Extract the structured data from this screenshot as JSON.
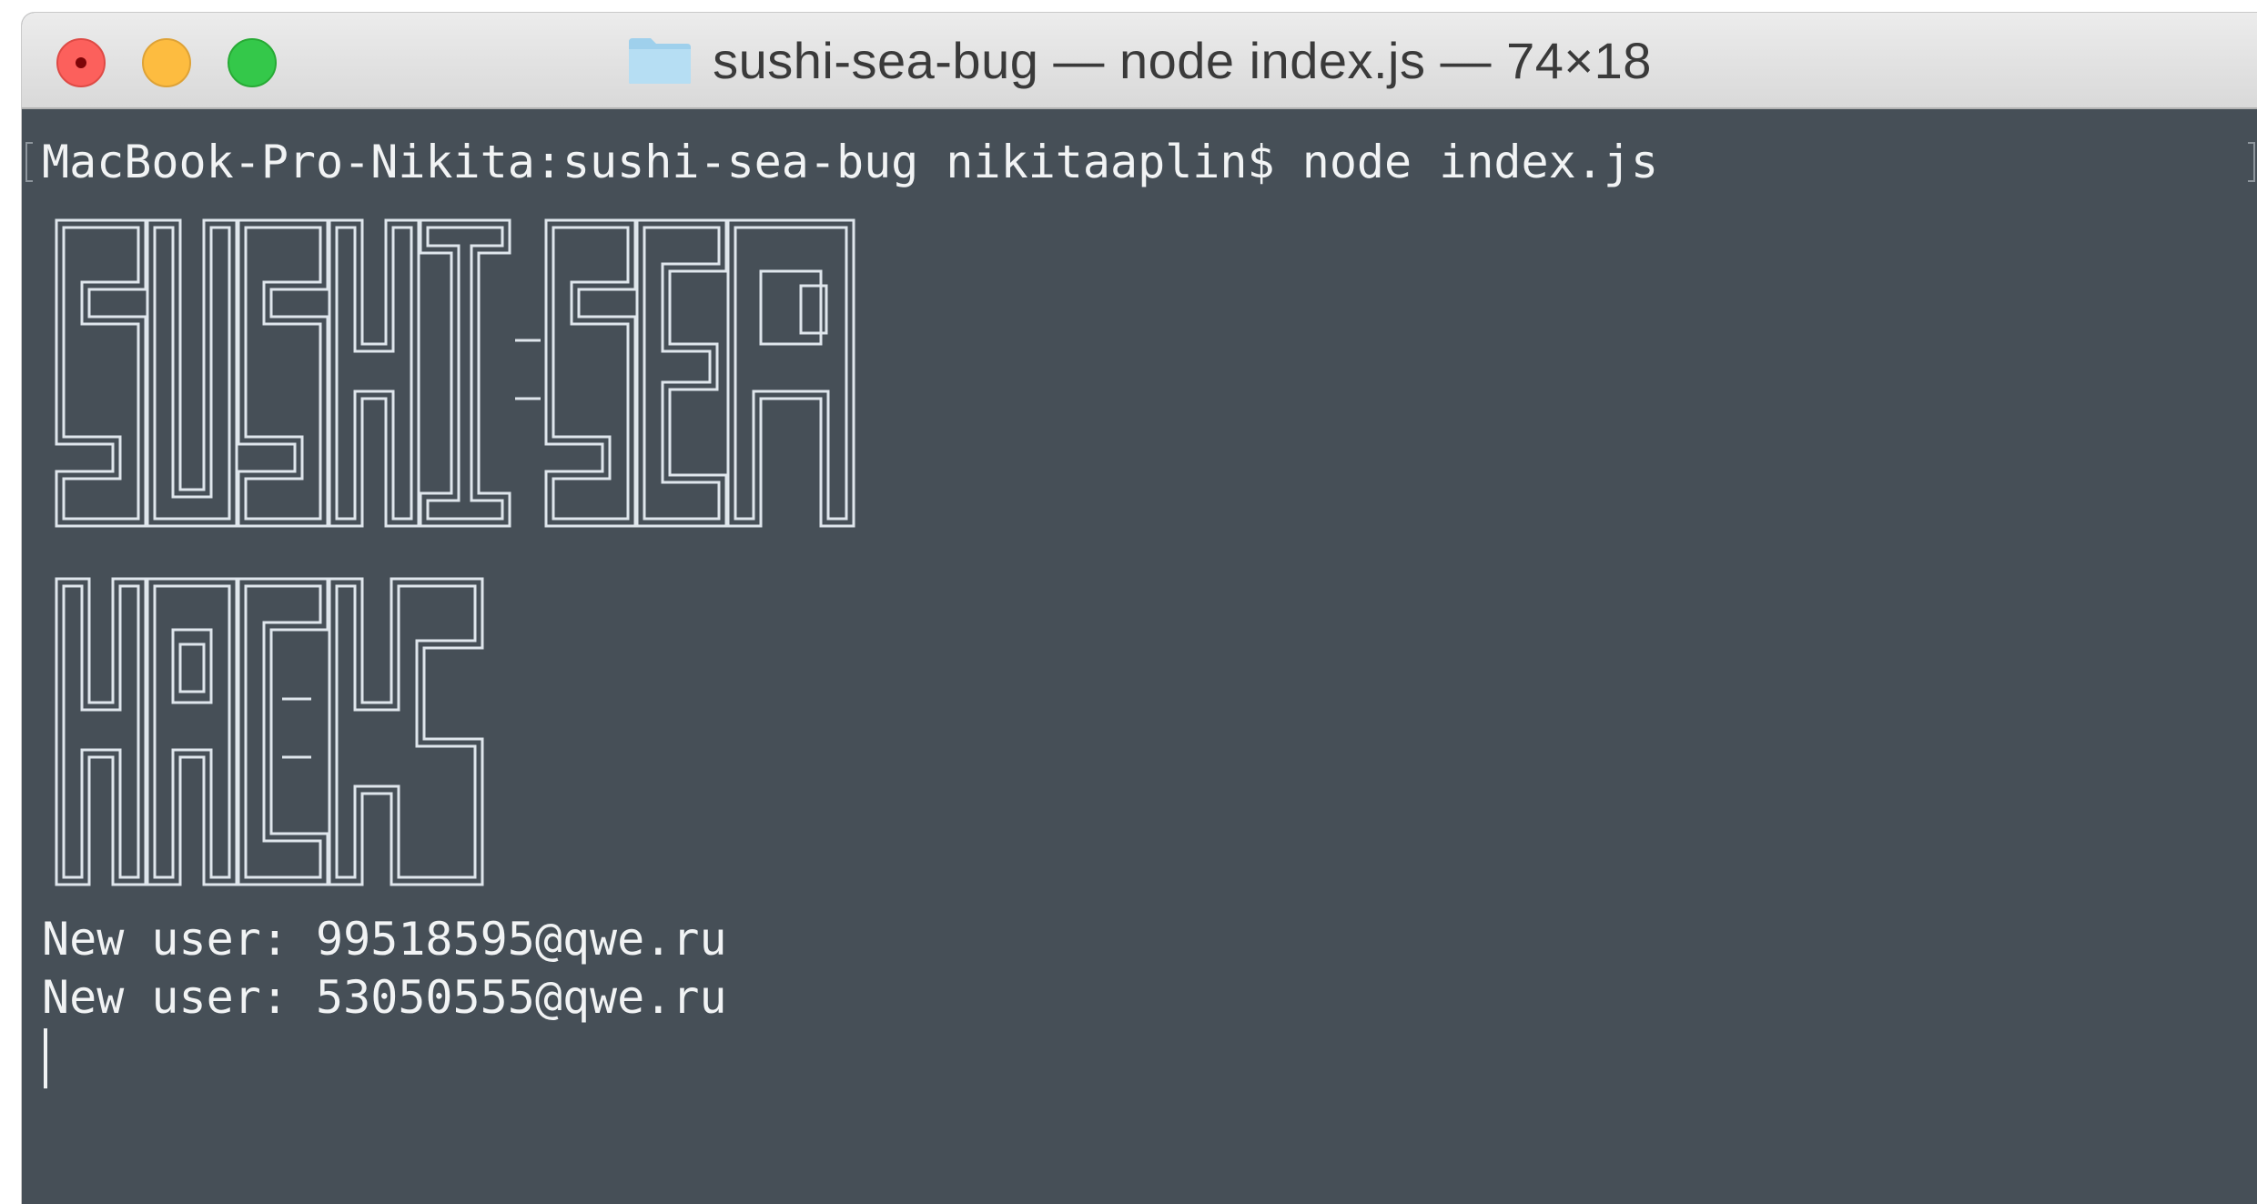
{
  "window": {
    "title": "sushi-sea-bug — node index.js — 74×18",
    "folder_icon": "folder-icon"
  },
  "terminal": {
    "prompt_line": "MacBook-Pro-Nikita:sushi-sea-bug nikitaaplin$ node index.js",
    "banner_line1": "SUSHI-SEA",
    "banner_line2": "HACK",
    "output": [
      "New user: 99518595@qwe.ru",
      "New user: 53050555@qwe.ru"
    ]
  },
  "colors": {
    "background": "#464f57",
    "text": "#f1f3f4",
    "close": "#fc605c",
    "minimize": "#fdbc40",
    "zoom": "#34c84a"
  }
}
